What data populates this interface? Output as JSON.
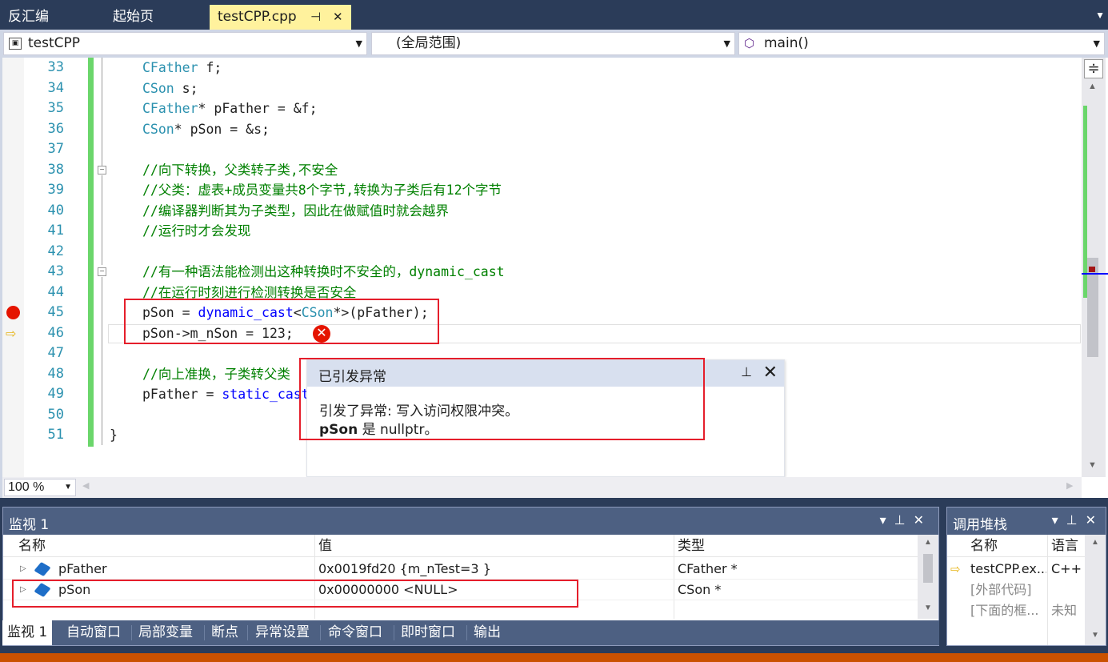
{
  "tabs": [
    {
      "label": "反汇编",
      "active": false
    },
    {
      "label": "起始页",
      "active": false
    },
    {
      "label": "testCPP.cpp",
      "active": true
    }
  ],
  "tab_pin_glyph": "⊣",
  "tab_close_glyph": "✕",
  "nav": {
    "project": "testCPP",
    "scope": "(全局范围)",
    "member": "main()"
  },
  "editor": {
    "line_numbers": [
      "33",
      "34",
      "35",
      "36",
      "37",
      "38",
      "39",
      "40",
      "41",
      "42",
      "43",
      "44",
      "45",
      "46",
      "47",
      "48",
      "49",
      "50",
      "51"
    ],
    "zoom": "100 %"
  },
  "exception_popup": {
    "title": "已引发异常",
    "message": "引发了异常: 写入访问权限冲突。",
    "detail_var": "pSon",
    "detail_rest": " 是 nullptr。"
  },
  "watch": {
    "title": "监视 1",
    "columns": [
      "名称",
      "值",
      "类型"
    ],
    "rows": [
      {
        "name": "pFather",
        "value": "0x0019fd20 {m_nTest=3 }",
        "type": "CFather *"
      },
      {
        "name": "pSon",
        "value": "0x00000000 <NULL>",
        "type": "CSon *"
      }
    ]
  },
  "bottom_tabs": [
    "监视 1",
    "自动窗口",
    "局部变量",
    "断点",
    "异常设置",
    "命令窗口",
    "即时窗口",
    "输出"
  ],
  "callstack": {
    "title": "调用堆栈",
    "columns": [
      "名称",
      "语言"
    ],
    "rows": [
      {
        "name": "testCPP.ex...",
        "lang": "C++"
      },
      {
        "name": "[外部代码]",
        "lang": ""
      },
      {
        "name": "[下面的框...",
        "lang": "未知"
      }
    ]
  },
  "colors": {
    "error": "#e51400",
    "active_tab": "#fff29d",
    "panel_title": "#4d6082",
    "status_bar": "#ca5100"
  }
}
